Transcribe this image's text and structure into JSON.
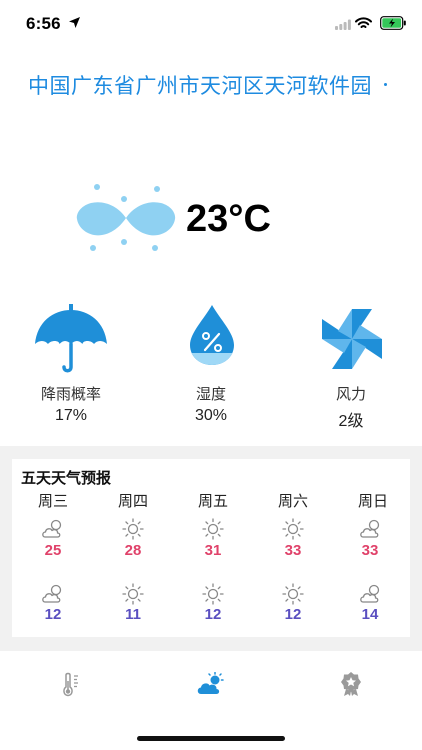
{
  "status_bar": {
    "time": "6:56"
  },
  "location": "中国广东省广州市天河区天河软件园",
  "current": {
    "temperature": "23°C",
    "icon": "sleet-icon"
  },
  "metrics": [
    {
      "label": "降雨概率",
      "value": "17%",
      "icon": "umbrella-icon"
    },
    {
      "label": "湿度",
      "value": "30%",
      "icon": "humidity-drop-icon"
    },
    {
      "label": "风力",
      "value": "2级",
      "icon": "pinwheel-icon"
    }
  ],
  "forecast": {
    "title": "五天天气预报",
    "days": [
      {
        "day": "周三",
        "high": "25",
        "low": "12",
        "high_icon": "partly-cloudy-icon",
        "low_icon": "partly-cloudy-icon"
      },
      {
        "day": "周四",
        "high": "28",
        "low": "11",
        "high_icon": "sunny-icon",
        "low_icon": "sunny-icon"
      },
      {
        "day": "周五",
        "high": "31",
        "low": "12",
        "high_icon": "sunny-icon",
        "low_icon": "sunny-icon"
      },
      {
        "day": "周六",
        "high": "33",
        "low": "12",
        "high_icon": "sunny-icon",
        "low_icon": "sunny-icon"
      },
      {
        "day": "周日",
        "high": "33",
        "low": "14",
        "high_icon": "partly-cloudy-icon",
        "low_icon": "partly-cloudy-icon"
      }
    ]
  },
  "tabs": [
    {
      "name": "temperature-tab",
      "icon": "thermometer-icon",
      "active": false
    },
    {
      "name": "weather-tab",
      "icon": "cloud-sun-icon",
      "active": true
    },
    {
      "name": "badge-tab",
      "icon": "award-badge-icon",
      "active": false
    }
  ],
  "colors": {
    "accent": "#1e8be0",
    "high_temp": "#e0426a",
    "low_temp": "#5a4fc0"
  }
}
